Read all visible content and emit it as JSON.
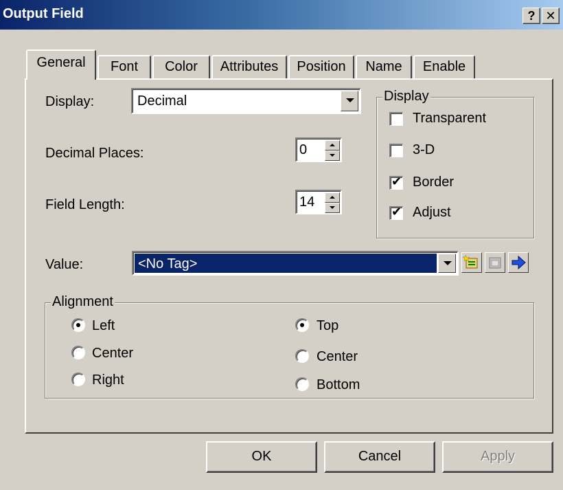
{
  "window": {
    "title": "Output Field",
    "help_label": "?",
    "close_label": "✕"
  },
  "tabs": [
    {
      "label": "General",
      "active": true
    },
    {
      "label": "Font",
      "active": false
    },
    {
      "label": "Color",
      "active": false
    },
    {
      "label": "Attributes",
      "active": false
    },
    {
      "label": "Position",
      "active": false
    },
    {
      "label": "Name",
      "active": false
    },
    {
      "label": "Enable",
      "active": false
    }
  ],
  "general": {
    "display_label": "Display:",
    "display_value": "Decimal",
    "decimal_places_label": "Decimal Places:",
    "decimal_places_value": "0",
    "field_length_label": "Field Length:",
    "field_length_value": "14",
    "value_label": "Value:",
    "value_value": "<No Tag>"
  },
  "display_group": {
    "title": "Display",
    "options": [
      {
        "label": "Transparent",
        "checked": false
      },
      {
        "label": "3-D",
        "checked": false
      },
      {
        "label": "Border",
        "checked": true
      },
      {
        "label": "Adjust",
        "checked": true
      }
    ]
  },
  "alignment_group": {
    "title": "Alignment",
    "horizontal": [
      {
        "label": "Left",
        "selected": true
      },
      {
        "label": "Center",
        "selected": false
      },
      {
        "label": "Right",
        "selected": false
      }
    ],
    "vertical": [
      {
        "label": "Top",
        "selected": true
      },
      {
        "label": "Center",
        "selected": false
      },
      {
        "label": "Bottom",
        "selected": false
      }
    ]
  },
  "value_buttons": {
    "icons": [
      "tag-browse-icon",
      "tag-properties-icon",
      "go-to-tag-icon"
    ]
  },
  "buttons": {
    "ok": "OK",
    "cancel": "Cancel",
    "apply": "Apply"
  },
  "check_mark": "✔",
  "colors": {
    "title_start": "#0a246a",
    "title_end": "#a6caf0",
    "face": "#d4d0c8",
    "selection": "#0a246a"
  }
}
